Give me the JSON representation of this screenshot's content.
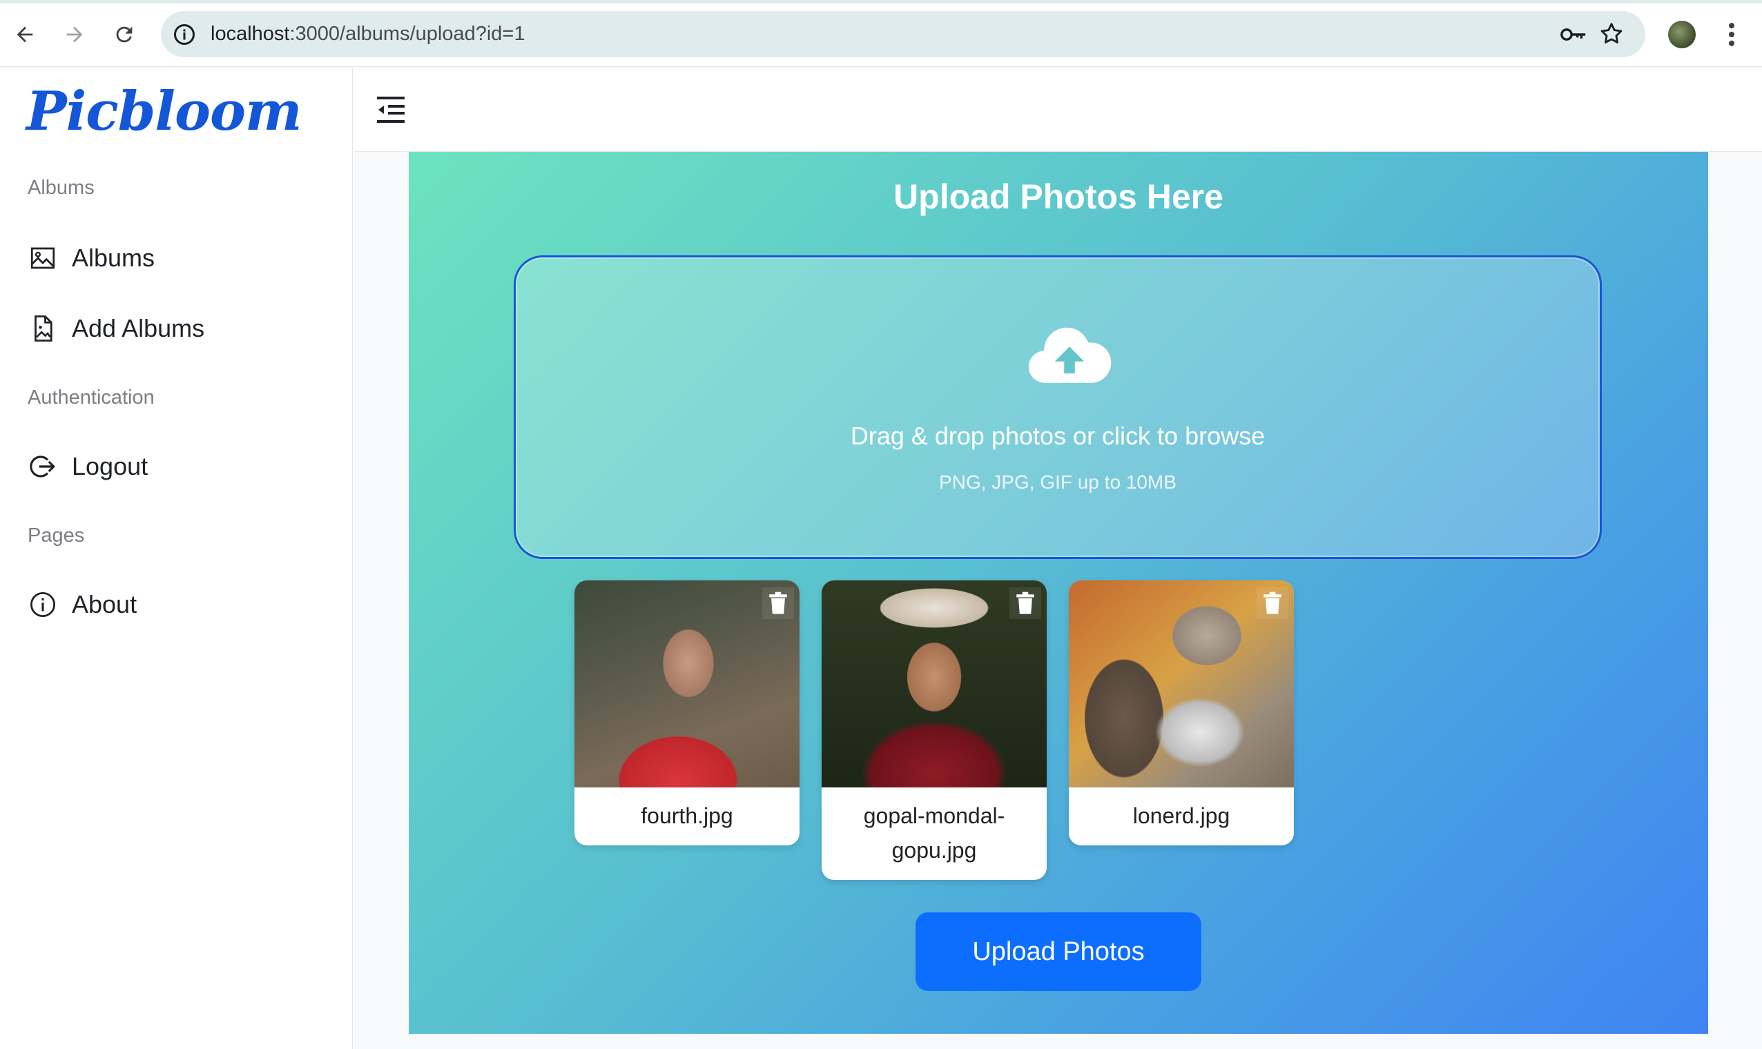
{
  "browser": {
    "url_host": "localhost",
    "url_path": ":3000/albums/upload?id=1"
  },
  "sidebar": {
    "logo": "Picbloom",
    "sections": [
      {
        "label": "Albums",
        "items": [
          {
            "label": "Albums",
            "icon": "image-icon"
          },
          {
            "label": "Add Albums",
            "icon": "file-image-icon"
          }
        ]
      },
      {
        "label": "Authentication",
        "items": [
          {
            "label": "Logout",
            "icon": "logout-icon"
          }
        ]
      },
      {
        "label": "Pages",
        "items": [
          {
            "label": "About",
            "icon": "info-icon"
          }
        ]
      }
    ]
  },
  "upload": {
    "title": "Upload Photos Here",
    "drop_text": "Drag & drop photos or click to browse",
    "drop_hint": "PNG, JPG, GIF up to 10MB",
    "button_label": "Upload Photos",
    "files": [
      {
        "name": "fourth.jpg"
      },
      {
        "name": "gopal-mondal-gopu.jpg"
      },
      {
        "name": "lonerd.jpg"
      }
    ]
  },
  "colors": {
    "brand": "#1456d8",
    "primary_button": "#0d6efd",
    "panel_gradient_start": "#6ce3bf",
    "panel_gradient_end": "#3f84f2"
  }
}
